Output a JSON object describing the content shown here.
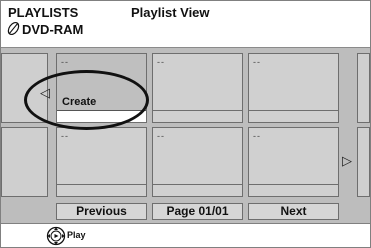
{
  "header": {
    "section": "PLAYLISTS",
    "view": "Playlist View",
    "disc": "DVD-RAM"
  },
  "grid": {
    "cells": [
      {
        "label": "--",
        "action": "Create"
      },
      {
        "label": "--"
      },
      {
        "label": "--"
      },
      {
        "label": "--"
      },
      {
        "label": "--"
      },
      {
        "label": "--"
      }
    ]
  },
  "nav": {
    "previous": "Previous",
    "page": "Page 01/01",
    "next": "Next"
  },
  "footer": {
    "play": "Play"
  },
  "icons": {
    "disc": "disc-icon",
    "left": "arrow-left-icon",
    "right": "arrow-right-icon",
    "play": "play-dial-icon"
  }
}
